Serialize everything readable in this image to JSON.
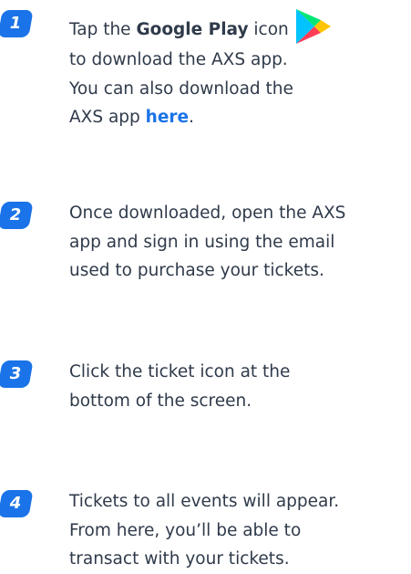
{
  "steps": [
    {
      "number": "1",
      "line1_prefix": "Tap the ",
      "line1_bold": "Google Play",
      "line1_suffix": " icon",
      "line2": "to download the AXS app.",
      "line3": "You can also download the",
      "line4_prefix": "AXS app ",
      "line4_link": "here",
      "line4_suffix": "."
    },
    {
      "number": "2",
      "lines": [
        "Once downloaded, open the AXS",
        "app and sign in using the email",
        "used to purchase your tickets."
      ]
    },
    {
      "number": "3",
      "lines": [
        "Click the ticket icon at the",
        "bottom of the screen."
      ]
    },
    {
      "number": "4",
      "lines": [
        "Tickets to all events will appear.",
        "From here, you’ll be able to",
        "transact with your tickets."
      ]
    }
  ],
  "icons": {
    "google_play": "google-play-icon"
  },
  "colors": {
    "badge": "#1a73e8",
    "link": "#1a73e8",
    "text": "#2f3a4a"
  }
}
